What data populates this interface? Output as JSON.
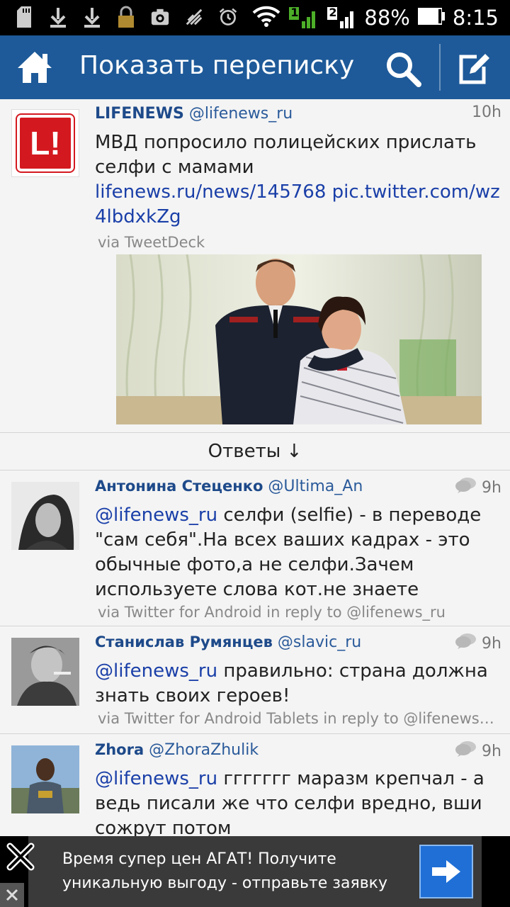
{
  "status_bar": {
    "battery": "88%",
    "time": "8:15",
    "sim_slot_1": "1",
    "sim_slot_2": "2",
    "icons": [
      "sd-card-icon",
      "download-icon",
      "download-icon",
      "lock-icon",
      "camera-icon",
      "no-signal-icon",
      "alarm-icon",
      "wifi-icon",
      "signal-icon",
      "signal-icon",
      "battery-icon"
    ]
  },
  "action_bar": {
    "title": "Показать переписку",
    "home_icon": "home-icon",
    "search_icon": "search-icon",
    "compose_icon": "compose-icon",
    "color": "#1e5a99"
  },
  "main_tweet": {
    "name": "LIFENEWS",
    "handle": "@lifenews_ru",
    "time": "10h",
    "text": "МВД попросило полицейских прислать селфи с мамами",
    "link1": "lifenews.ru/news/145768",
    "link2": "pic.twitter.com/wz4lbdxkZg",
    "via": "via TweetDeck",
    "avatar_text": "L!"
  },
  "replies_label": "Ответы ↓",
  "replies": [
    {
      "name": "Антонина Стеценко",
      "handle": "@Ultima_An",
      "time": "9h",
      "mention": "@lifenews_ru",
      "text": " селфи (selfie) - в переводе \"сам себя\".На всех ваших кадрах - это обычные фото,а не селфи.Зачем используете слова кот.не знаете",
      "via": "via Twitter for Android in reply to @lifenews_ru"
    },
    {
      "name": "Станислав Румянцев",
      "handle": "@slavic_ru",
      "time": "9h",
      "mention": "@lifenews_ru",
      "text": " правильно: страна должна знать своих героев!",
      "via": "via Twitter for Android Tablets in reply to @lifenews_ru"
    },
    {
      "name": "Zhora",
      "handle": "@ZhoraZhulik",
      "time": "9h",
      "mention": "@lifenews_ru",
      "text": " ггггггг маразм крепчал - а ведь писали же что селфи вредно, вши сожрут потом",
      "via": ""
    }
  ],
  "ad": {
    "text": "Время супер цен АГАТ! Получите уникальную выгоду - отправьте заявку",
    "arrow_icon": "arrow-right-icon",
    "button_color": "#1f6fd6"
  }
}
